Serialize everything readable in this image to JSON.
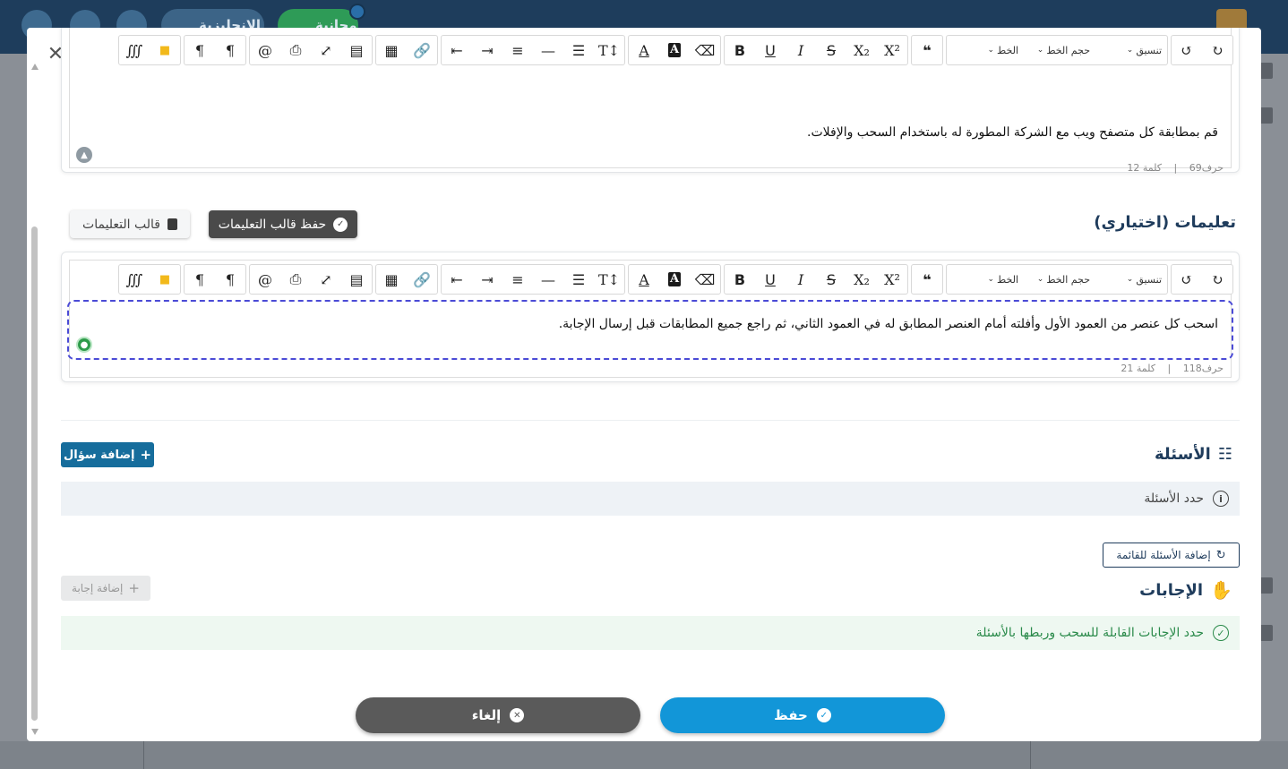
{
  "background": {
    "lang_label": "الإنجليزية",
    "free_label": "مجانية"
  },
  "editor_toolbar": {
    "font_label": "الخط",
    "font_size_label": "حجم الخط",
    "format_label": "تنسيق"
  },
  "editor_main": {
    "text": "قم بمطابقة كل متصفح ويب مع الشركة المطورة له باستخدام السحب والإفلات.",
    "char_count": "حرف69",
    "separator": "|",
    "word_count": "كلمة 12"
  },
  "instructions": {
    "title": "تعليمات (اختياري)",
    "save_template_label": "حفظ قالب التعليمات",
    "template_label": "قالب التعليمات",
    "text": "اسحب كل عنصر من العمود الأول وأفلته أمام العنصر المطابق له في العمود الثاني، ثم راجع جميع المطابقات قبل إرسال الإجابة.",
    "char_count": "حرف118",
    "separator": "|",
    "word_count": "كلمة 21"
  },
  "questions": {
    "title": "الأسئلة",
    "add_button_label": "إضافة سؤال",
    "info_text": "حدد الأسئلة"
  },
  "answers": {
    "add_to_list_label": "إضافة الأسئلة للقائمة",
    "title": "الإجابات",
    "add_answer_label": "إضافة إجابة",
    "success_text": "حدد الإجابات القابلة للسحب وربطها بالأسئلة"
  },
  "footer": {
    "cancel_label": "إلغاء",
    "save_label": "حفظ"
  },
  "colors": {
    "primary": "#166d9c",
    "save": "#1296d8",
    "cancel": "#5a5a5a",
    "focus_dash": "#4b4bd6",
    "success": "#2a8a4a"
  }
}
